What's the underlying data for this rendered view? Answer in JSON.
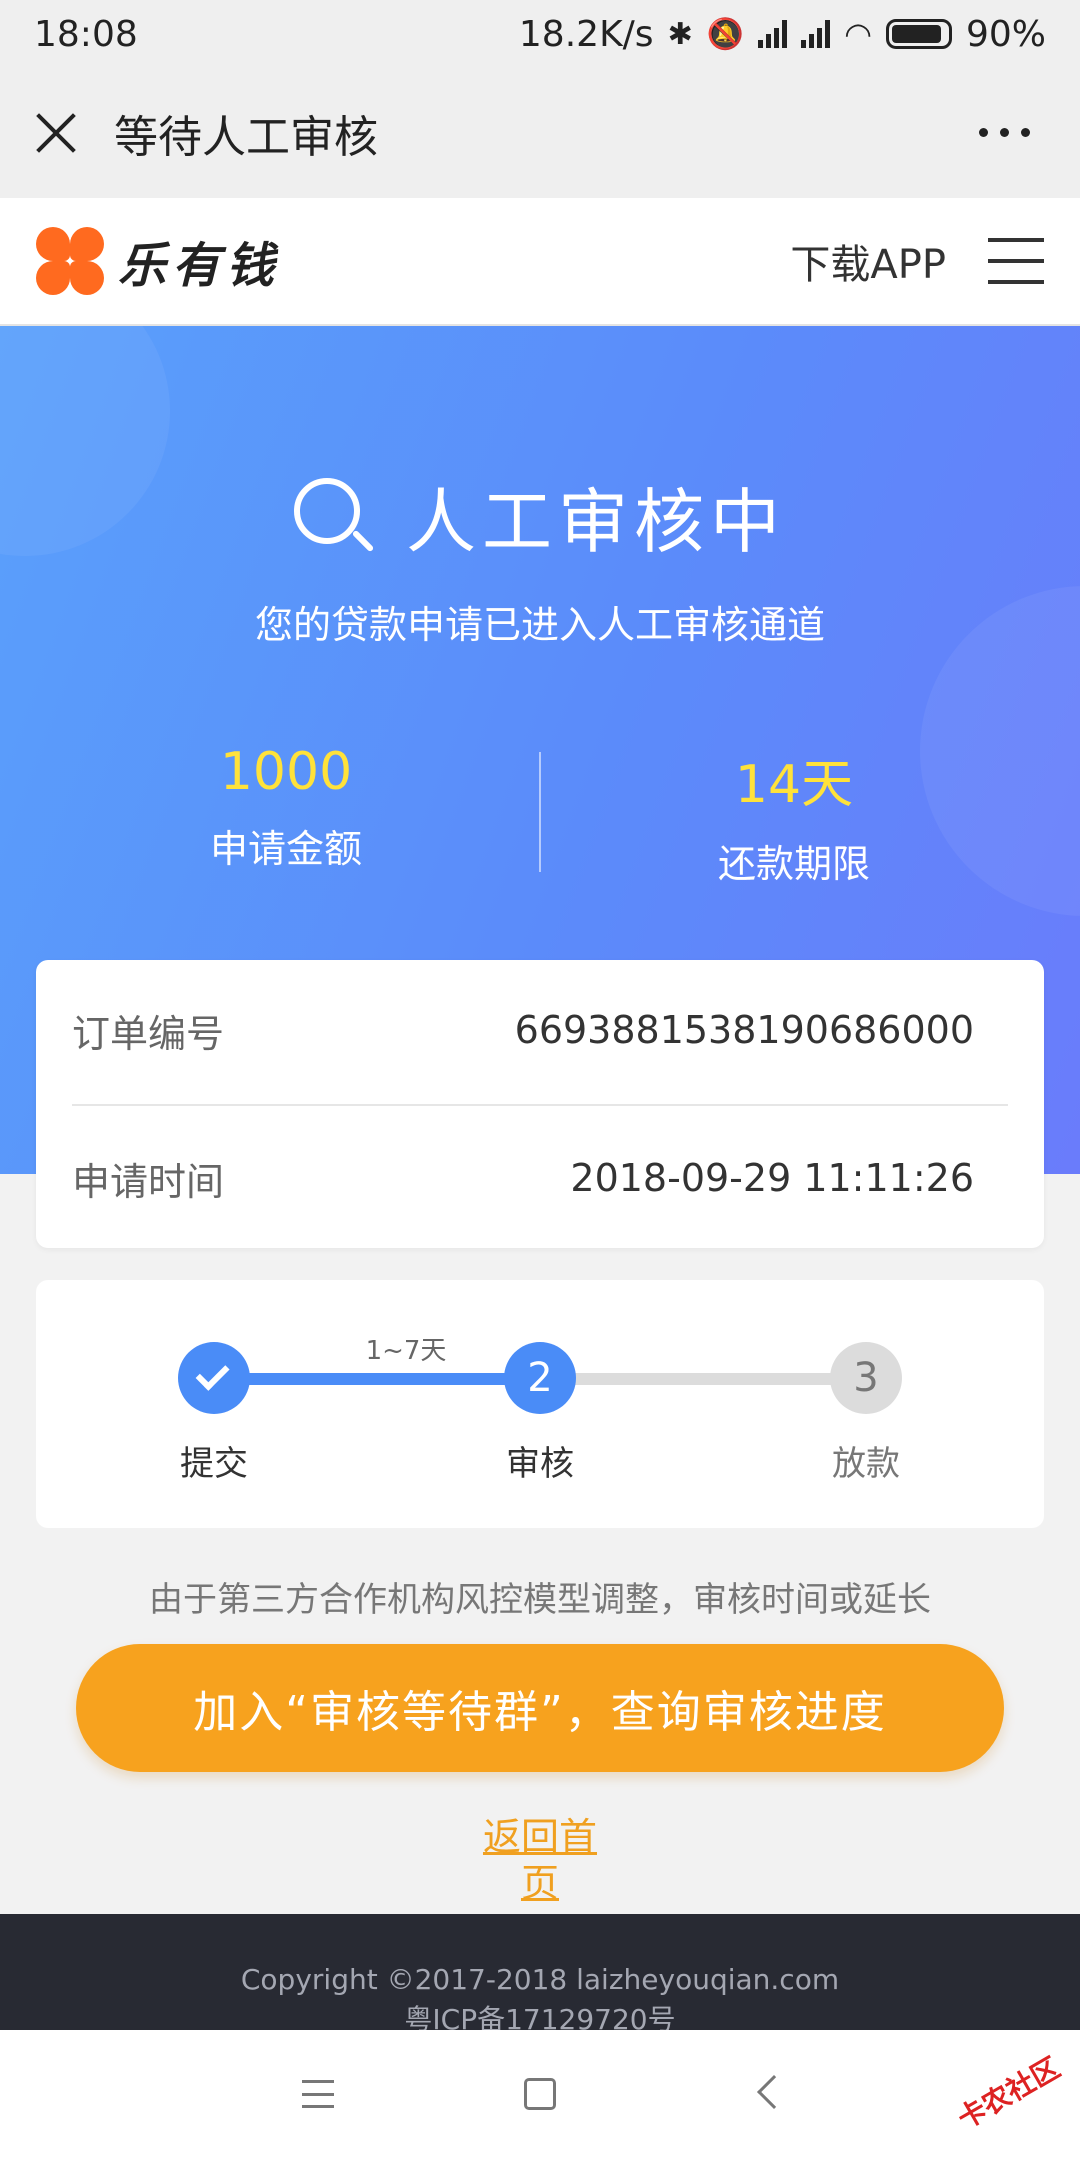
{
  "status_bar": {
    "time": "18:08",
    "net_speed": "18.2K/s",
    "battery": "90%",
    "battery_level": 0.9
  },
  "webview": {
    "title": "等待人工审核"
  },
  "site_header": {
    "brand": "乐有钱",
    "download": "下载APP"
  },
  "hero": {
    "title": "人工审核中",
    "subtitle": "您的贷款申请已进入人工审核通道",
    "stats": [
      {
        "value": "1000",
        "label": "申请金额"
      },
      {
        "value": "14天",
        "label": "还款期限"
      }
    ]
  },
  "order": {
    "rows": [
      {
        "label": "订单编号",
        "value": "6693881538190686000"
      },
      {
        "label": "申请时间",
        "value": "2018-09-29 11:11:26"
      }
    ]
  },
  "progress": {
    "duration": "1~7天",
    "steps": [
      {
        "number": "",
        "label": "提交",
        "state": "done"
      },
      {
        "number": "2",
        "label": "审核",
        "state": "current"
      },
      {
        "number": "3",
        "label": "放款",
        "state": "pending"
      }
    ]
  },
  "notice": "由于第三方合作机构风控模型调整，审核时间或延长",
  "cta": "加入“审核等待群”，查询审核进度",
  "back_link": "返回首页",
  "footer": {
    "copyright": "Copyright ©2017-2018 laizheyouqian.com",
    "icp": "粤ICP备17129720号"
  },
  "watermark": "卡农社区",
  "colors": {
    "accent_blue": "#4a8cf7",
    "cta_orange": "#f7a21e",
    "stat_yellow": "#ffe23a",
    "logo_orange": "#ff6a1f"
  }
}
